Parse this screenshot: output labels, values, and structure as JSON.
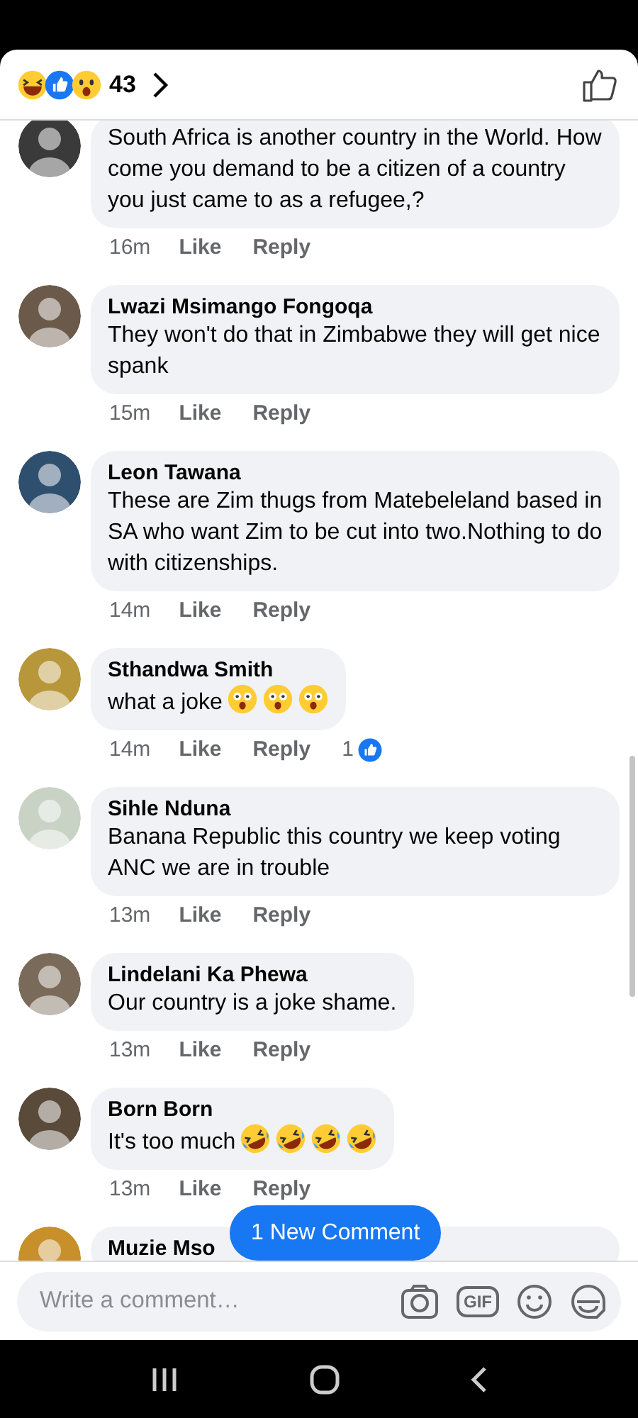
{
  "header": {
    "reactions": [
      {
        "kind": "haha"
      },
      {
        "kind": "like"
      },
      {
        "kind": "wow"
      }
    ],
    "count": "43"
  },
  "comments": [
    {
      "text": "South Africa is another country in the World. How come you demand to be a citizen of a country you just came to as a refugee,?",
      "time": "16m",
      "like": "Like",
      "reply": "Reply"
    },
    {
      "name": "Lwazi Msimango Fongoqa",
      "text": "They won't do that in Zimbabwe they will get nice spank",
      "time": "15m",
      "like": "Like",
      "reply": "Reply"
    },
    {
      "name": "Leon Tawana",
      "text": "These are Zim thugs from Matebeleland based in SA who want Zim to be cut into two.Nothing to do with citizenships.",
      "time": "14m",
      "like": "Like",
      "reply": "Reply"
    },
    {
      "name": "Sthandwa Smith",
      "text": "what a joke",
      "emojis": [
        {
          "kind": "astonished"
        },
        {
          "kind": "astonished"
        },
        {
          "kind": "astonished"
        }
      ],
      "time": "14m",
      "like": "Like",
      "reply": "Reply",
      "like_count": "1"
    },
    {
      "name": "Sihle Nduna",
      "text": "Banana Republic this country we keep voting ANC we are in trouble",
      "time": "13m",
      "like": "Like",
      "reply": "Reply"
    },
    {
      "name": "Lindelani Ka Phewa",
      "text": "Our country is a joke shame.",
      "time": "13m",
      "like": "Like",
      "reply": "Reply"
    },
    {
      "name": "Born Born",
      "text": "It's too much",
      "emojis": [
        {
          "kind": "rofl"
        },
        {
          "kind": "rofl"
        },
        {
          "kind": "rofl"
        },
        {
          "kind": "rofl"
        }
      ],
      "time": "13m",
      "like": "Like",
      "reply": "Reply"
    },
    {
      "name": "Muzie Mso"
    }
  ],
  "new_comment_pill": "1 New Comment",
  "composer": {
    "placeholder": "Write a comment…",
    "gif_label": "GIF"
  }
}
